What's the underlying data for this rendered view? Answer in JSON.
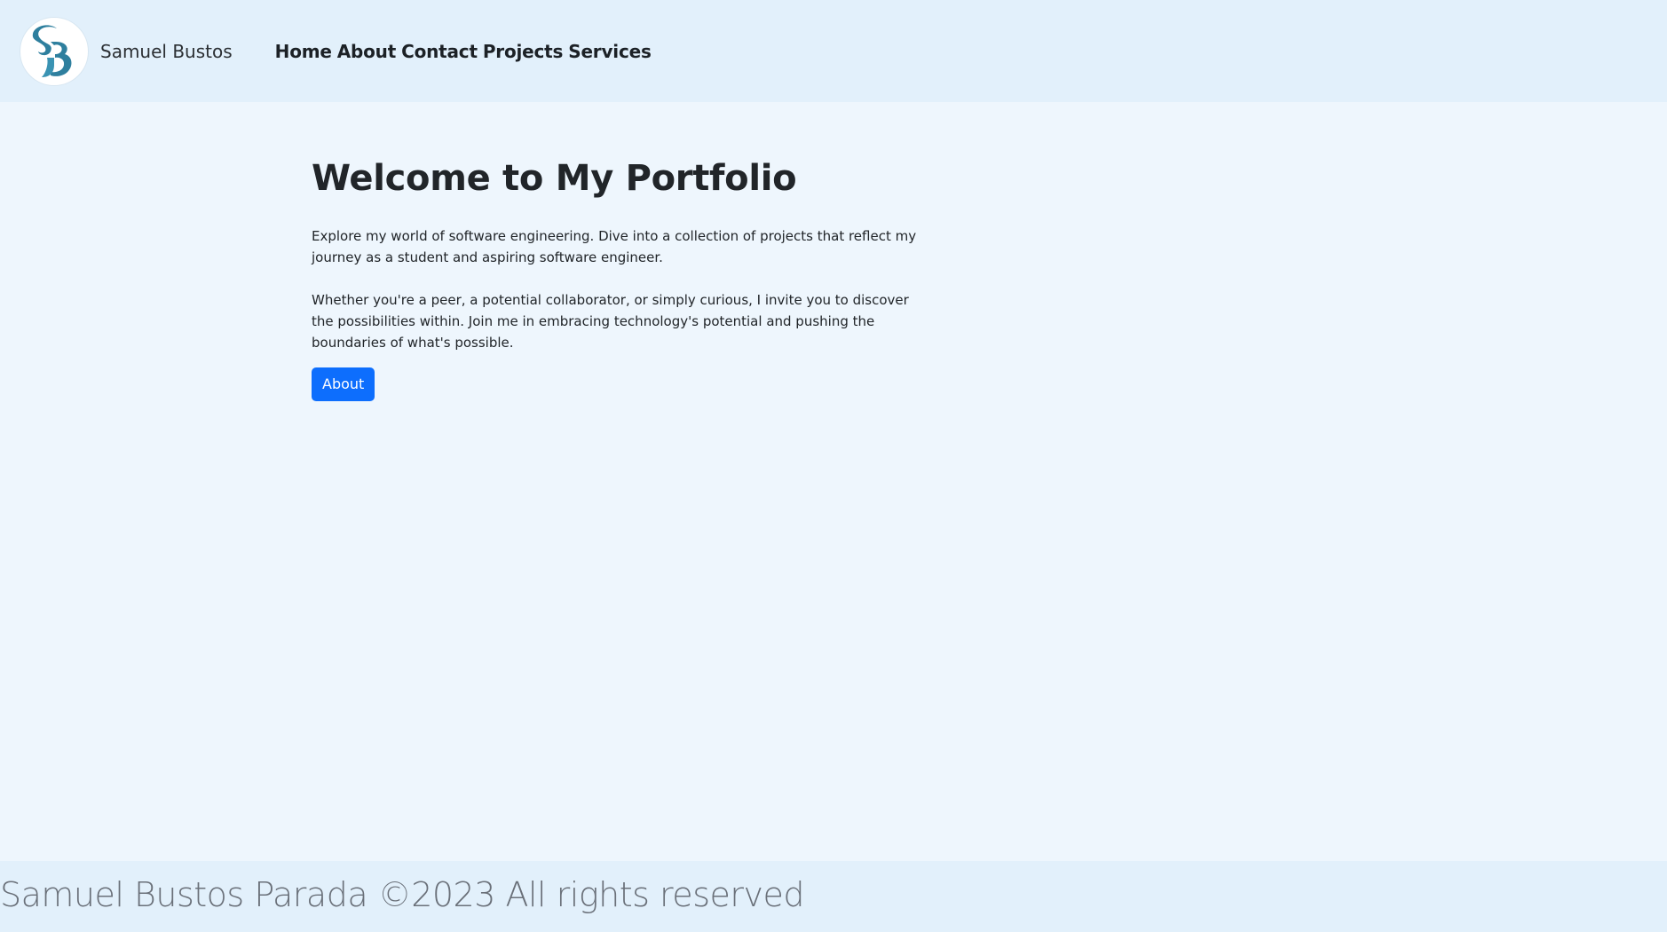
{
  "nav": {
    "brand_name": "Samuel Bustos",
    "logo_icon": "sb-monogram-logo",
    "links": [
      "Home",
      "About",
      "Contact",
      "Projects",
      "Services"
    ]
  },
  "hero": {
    "title": "Welcome to My Portfolio",
    "paragraph1": "Explore my world of software engineering. Dive into a collection of projects that reflect my journey as a student and aspiring software engineer.",
    "paragraph2": "Whether you're a peer, a potential collaborator, or simply curious, I invite you to discover the possibilities within. Join me in embracing technology's potential and pushing the boundaries of what's possible.",
    "button_label": "About"
  },
  "footer": {
    "text": "Samuel Bustos Parada ©2023 All rights reserved"
  },
  "colors": {
    "navbar_bg": "#e2f0fb",
    "page_bg": "#eef6fd",
    "button_primary": "#0d6efd",
    "logo_teal": "#2e7f9e"
  }
}
